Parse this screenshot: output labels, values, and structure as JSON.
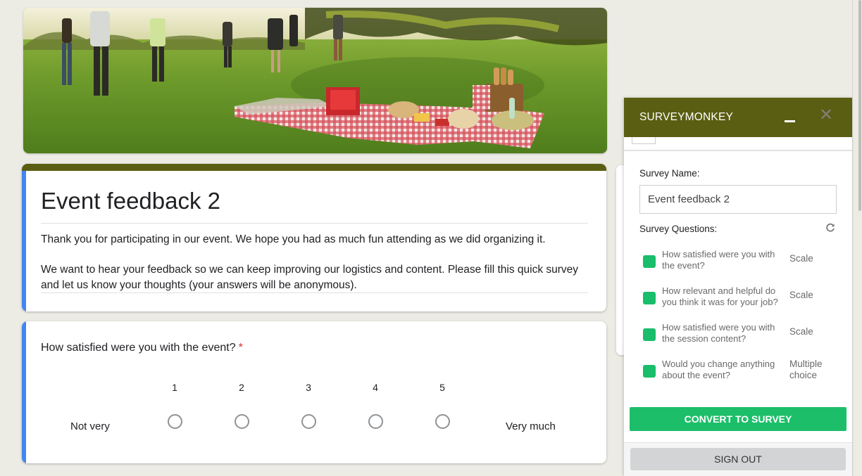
{
  "form": {
    "title": "Event feedback 2",
    "description": [
      "Thank you for participating in our event. We hope you had as much fun attending as we did organizing it.",
      "We want to hear your feedback so we can keep improving our logistics and content. Please fill this quick survey and let us know your thoughts (your answers will be anonymous)."
    ],
    "theme_color": "#5a5e12",
    "accent_color": "#4285f4",
    "header_image": "picnic-in-park-image"
  },
  "question": {
    "title": "How satisfied were you with the event?",
    "required_marker": "*",
    "scale": [
      "1",
      "2",
      "3",
      "4",
      "5"
    ],
    "low_label": "Not very",
    "high_label": "Very much"
  },
  "panel": {
    "title": "SURVEYMONKEY",
    "minimize_icon": "minimize-icon",
    "close_icon": "close-icon",
    "close_glyph": "✕",
    "survey_name_label": "Survey Name:",
    "survey_name_value": "Event feedback 2",
    "survey_questions_label": "Survey Questions:",
    "refresh_icon": "refresh-icon",
    "questions": [
      {
        "text": "How satisfied were you with the event?",
        "type": "Scale",
        "checked": true
      },
      {
        "text": "How relevant and helpful do you think it was for your job?",
        "type": "Scale",
        "checked": true
      },
      {
        "text": "How satisfied were you with the session content?",
        "type": "Scale",
        "checked": true
      },
      {
        "text": "Would you change anything about the event?",
        "type": "Multiple choice",
        "checked": true
      }
    ],
    "convert_label": "CONVERT TO SURVEY",
    "signout_label": "SIGN OUT",
    "brand_color": "#5a5e12",
    "checkbox_color": "#19bd6b"
  }
}
